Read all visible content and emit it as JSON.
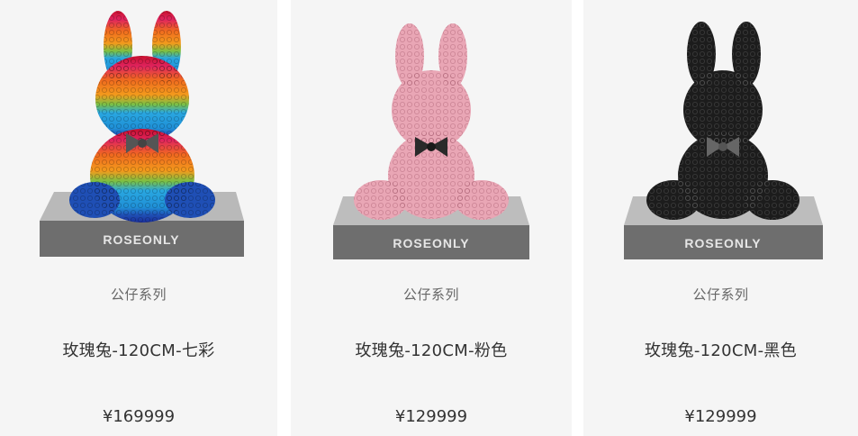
{
  "brand_label": "ROSEONLY",
  "products": [
    {
      "series": "公仔系列",
      "name": "玫瑰兔-120CM-七彩",
      "price": "¥169999",
      "colors": [
        "#c8102e",
        "#e8175d",
        "#f06a1f",
        "#f7a21b",
        "#7bc043",
        "#29a7e1",
        "#1f4fb5"
      ],
      "bow_color": "#555555"
    },
    {
      "series": "公仔系列",
      "name": "玫瑰兔-120CM-粉色",
      "price": "¥129999",
      "colors": [
        "#e9a6b5"
      ],
      "bow_color": "#2a2a2a"
    },
    {
      "series": "公仔系列",
      "name": "玫瑰兔-120CM-黑色",
      "price": "¥129999",
      "colors": [
        "#1c1c1c"
      ],
      "bow_color": "#666666"
    }
  ]
}
